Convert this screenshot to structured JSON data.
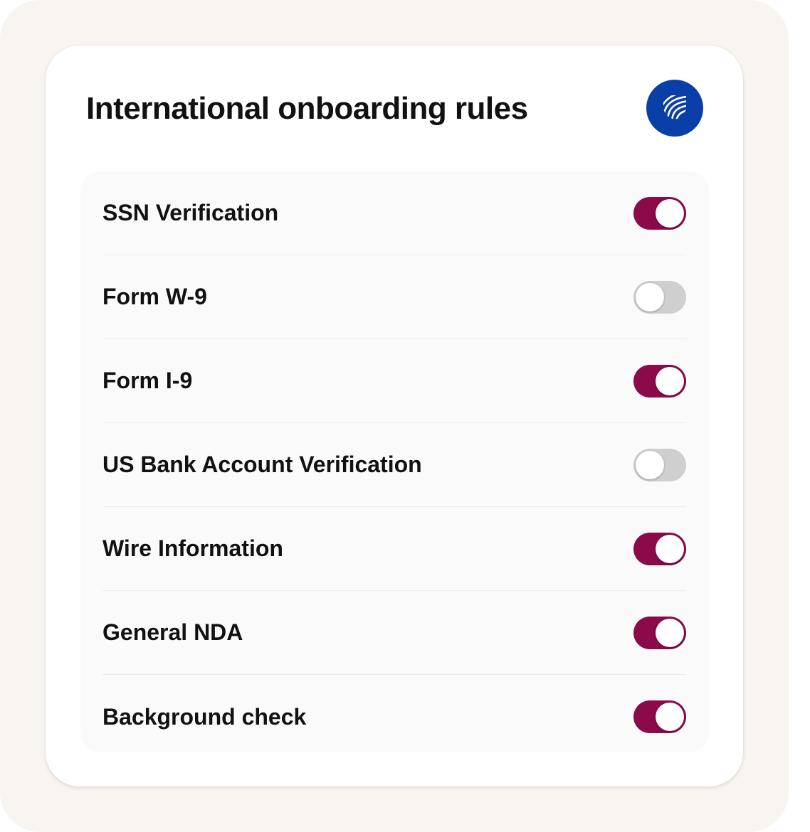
{
  "title": "International onboarding rules",
  "logo": {
    "icon": "shield-stripes-icon",
    "color": "#0b3fa8"
  },
  "colors": {
    "toggle_on": "#8a0a4a",
    "toggle_off": "#cfcfcf"
  },
  "rules": [
    {
      "label": "SSN Verification",
      "enabled": true
    },
    {
      "label": "Form W-9",
      "enabled": false
    },
    {
      "label": "Form I-9",
      "enabled": true
    },
    {
      "label": "US Bank Account Verification",
      "enabled": false
    },
    {
      "label": "Wire Information",
      "enabled": true
    },
    {
      "label": "General NDA",
      "enabled": true
    },
    {
      "label": "Background check",
      "enabled": true
    }
  ]
}
